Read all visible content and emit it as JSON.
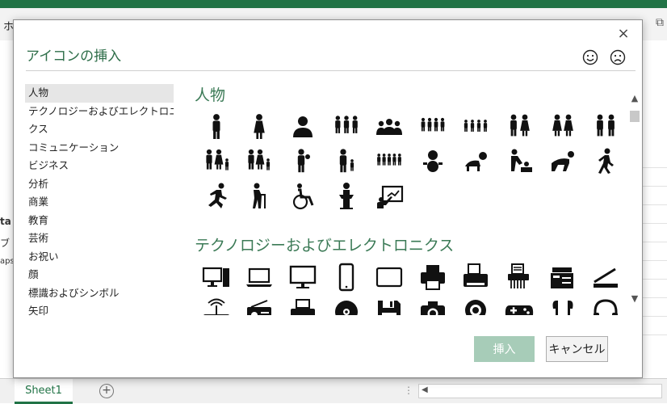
{
  "excel": {
    "home_tab": "ホ",
    "left_fragments": [
      "ta",
      "ブ",
      "aps"
    ],
    "sheet_tab": "Sheet1",
    "add_sheet": "+",
    "bottom_dots": "⋮",
    "scroll_left_arrow": "◀"
  },
  "dialog": {
    "title": "アイコンの挿入",
    "close": "×",
    "categories": [
      "人物",
      "テクノロジーおよびエレクトロニ",
      "クス",
      "コミュニケーション",
      "ビジネス",
      "分析",
      "商業",
      "教育",
      "芸術",
      "お祝い",
      "顔",
      "標識およびシンボル",
      "矢印"
    ],
    "selected_category_index": 0,
    "sections": [
      {
        "title": "人物",
        "icons": [
          [
            "man-icon",
            "woman-icon",
            "user-icon",
            "family-three-icon",
            "group-icon",
            "crowd-icon",
            "crowd-small-icon",
            "couple-icon",
            "two-women-icon",
            "two-men-icon"
          ],
          [
            "family-child-icon",
            "family-stroller-icon",
            "person-holding-baby-icon",
            "parent-child-icon",
            "big-family-icon",
            "baby-icon",
            "crawling-baby-icon",
            "diaper-changing-icon",
            "crawling-adult-icon",
            "walking-icon"
          ],
          [
            "running-icon",
            "elderly-icon",
            "wheelchair-icon",
            "speaker-podium-icon",
            "presentation-icon"
          ]
        ]
      },
      {
        "title": "テクノロジーおよびエレクトロニクス",
        "icons": [
          [
            "desktop-computer-icon",
            "laptop-icon",
            "monitor-icon",
            "smartphone-icon",
            "tablet-icon",
            "printer-icon",
            "fax-icon",
            "shredder-icon",
            "copier-icon",
            "scanner-icon"
          ],
          [
            "wifi-router-icon",
            "radio-icon",
            "inkjet-printer-icon",
            "cd-icon",
            "floppy-disk-icon",
            "camera-icon",
            "webcam-icon",
            "gamepad-icon",
            "earbuds-icon",
            "headphones-icon"
          ]
        ]
      }
    ],
    "buttons": {
      "insert": "挿入",
      "cancel": "キャンセル"
    },
    "scroll": {
      "up": "▲",
      "down": "▼"
    }
  },
  "colors": {
    "accent": "#2e6e49",
    "insert_disabled": "#a7ccb8",
    "excel_green": "#217346"
  }
}
